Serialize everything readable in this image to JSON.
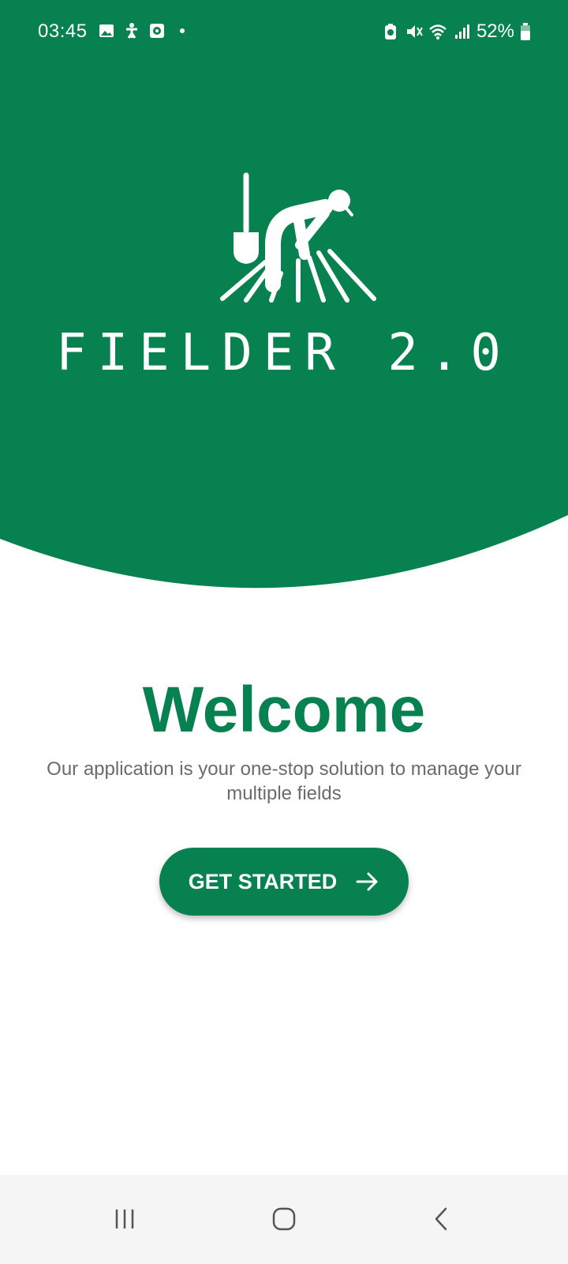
{
  "status_bar": {
    "time": "03:45",
    "battery_percent": "52%",
    "left_icons": [
      "gallery-icon",
      "accessibility-icon",
      "screen-recorder-icon",
      "notification-dot-icon"
    ],
    "right_icons": [
      "battery-saver-icon",
      "mute-icon",
      "wifi-icon",
      "signal-icon",
      "battery-icon"
    ]
  },
  "hero": {
    "brand": "FIELDER 2.0",
    "logo_icon": "farmer-digging-logo-icon"
  },
  "welcome": {
    "title": "Welcome",
    "description": "Our application is your one-stop solution to manage your multiple fields"
  },
  "cta": {
    "label": "GET STARTED",
    "icon": "arrow-right-icon"
  },
  "nav_bar": {
    "items": [
      "recent-apps-icon",
      "home-icon",
      "back-icon"
    ]
  },
  "colors": {
    "brand_green": "#078150",
    "text_gray": "#6b6b6b",
    "nav_bg": "#f5f5f5"
  }
}
